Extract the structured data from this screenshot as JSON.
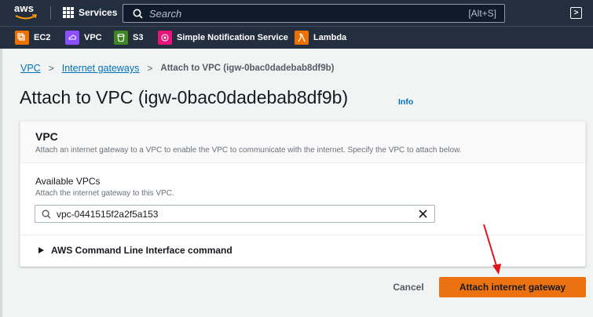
{
  "topnav": {
    "logo_text": "aws",
    "services_label": "Services",
    "search_placeholder": "Search",
    "search_shortcut": "[Alt+S]"
  },
  "favorites": [
    {
      "label": "EC2",
      "icon": "ec2-icon",
      "color": "#ed7100"
    },
    {
      "label": "VPC",
      "icon": "vpc-icon",
      "color": "#8c4fff"
    },
    {
      "label": "S3",
      "icon": "s3-icon",
      "color": "#3f8624"
    },
    {
      "label": "Simple Notification Service",
      "icon": "sns-icon",
      "color": "#e7157b"
    },
    {
      "label": "Lambda",
      "icon": "lambda-icon",
      "color": "#ed7100"
    }
  ],
  "breadcrumb": {
    "item1": "VPC",
    "item2": "Internet gateways",
    "current": "Attach to VPC (igw-0bac0dadebab8df9b)"
  },
  "page": {
    "title": "Attach to VPC (igw-0bac0dadebab8df9b)",
    "info": "Info"
  },
  "panel": {
    "title": "VPC",
    "description": "Attach an internet gateway to a VPC to enable the VPC to communicate with the internet. Specify the VPC to attach below.",
    "field_label": "Available VPCs",
    "field_description": "Attach the internet gateway to this VPC.",
    "vpc_value": "vpc-0441515f2a2f5a153",
    "expander_label": "AWS Command Line Interface command"
  },
  "actions": {
    "cancel": "Cancel",
    "primary": "Attach internet gateway"
  },
  "colors": {
    "nav_bg": "#232f3e",
    "link": "#0073bb",
    "primary": "#ec7211",
    "annotation_arrow": "#e0151c"
  }
}
